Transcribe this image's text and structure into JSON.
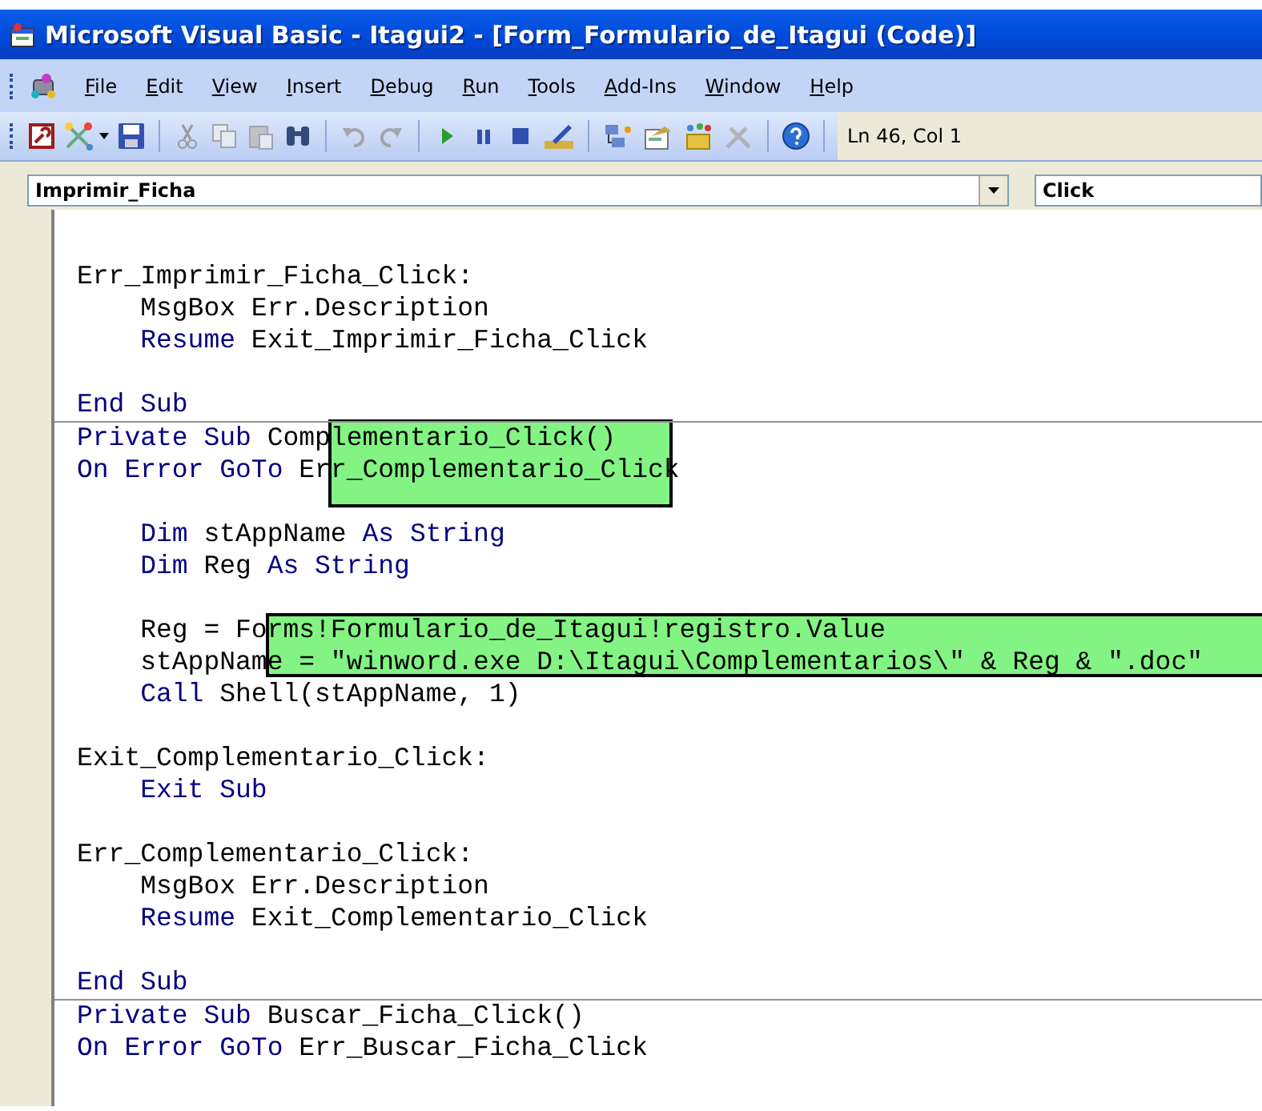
{
  "window": {
    "title": "Microsoft Visual Basic - Itagui2 - [Form_Formulario_de_Itagui (Code)]"
  },
  "menu": [
    "File",
    "Edit",
    "View",
    "Insert",
    "Debug",
    "Run",
    "Tools",
    "Add-Ins",
    "Window",
    "Help"
  ],
  "toolbar": {
    "position": "Ln 46, Col 1"
  },
  "object_combo": {
    "value": "Imprimir_Ficha"
  },
  "procedure_combo": {
    "value": "Click"
  },
  "code": [
    {
      "kind": "code",
      "tokens": [
        {
          "kind": "plain",
          "text": "Err_Imprimir_Ficha_Click:"
        }
      ]
    },
    {
      "kind": "code",
      "tokens": [
        {
          "kind": "plain",
          "text": "    MsgBox Err.Description"
        }
      ]
    },
    {
      "kind": "code",
      "tokens": [
        {
          "kind": "keyword",
          "text": "    Resume"
        },
        {
          "kind": "plain",
          "text": " Exit_Imprimir_Ficha_Click"
        }
      ]
    },
    {
      "kind": "blank"
    },
    {
      "kind": "code",
      "tokens": [
        {
          "kind": "keyword",
          "text": "End Sub"
        }
      ]
    },
    {
      "kind": "proc_start",
      "tokens": [
        {
          "kind": "keyword",
          "text": "Private Sub"
        },
        {
          "kind": "plain",
          "text": " Complementario_Click()"
        }
      ]
    },
    {
      "kind": "code",
      "tokens": [
        {
          "kind": "keyword",
          "text": "On Error GoTo"
        },
        {
          "kind": "plain",
          "text": " Err_Complementario_Click"
        }
      ]
    },
    {
      "kind": "blank"
    },
    {
      "kind": "code",
      "tokens": [
        {
          "kind": "keyword",
          "text": "    Dim"
        },
        {
          "kind": "plain",
          "text": " stAppName "
        },
        {
          "kind": "keyword",
          "text": "As String"
        }
      ]
    },
    {
      "kind": "code",
      "tokens": [
        {
          "kind": "keyword",
          "text": "    Dim"
        },
        {
          "kind": "plain",
          "text": " Reg "
        },
        {
          "kind": "keyword",
          "text": "As String"
        }
      ]
    },
    {
      "kind": "blank"
    },
    {
      "kind": "code",
      "tokens": [
        {
          "kind": "plain",
          "text": "    Reg = Forms!Formulario_de_Itagui!registro.Value"
        }
      ]
    },
    {
      "kind": "code",
      "tokens": [
        {
          "kind": "plain",
          "text": "    stAppName = \"winword.exe D:\\Itagui\\Complementarios\\\" & Reg & \".doc\""
        }
      ]
    },
    {
      "kind": "code",
      "tokens": [
        {
          "kind": "keyword",
          "text": "    Call"
        },
        {
          "kind": "plain",
          "text": " Shell(stAppName, 1)"
        }
      ]
    },
    {
      "kind": "blank"
    },
    {
      "kind": "code",
      "tokens": [
        {
          "kind": "plain",
          "text": "Exit_Complementario_Click:"
        }
      ]
    },
    {
      "kind": "code",
      "tokens": [
        {
          "kind": "keyword",
          "text": "    Exit Sub"
        }
      ]
    },
    {
      "kind": "blank"
    },
    {
      "kind": "code",
      "tokens": [
        {
          "kind": "plain",
          "text": "Err_Complementario_Click:"
        }
      ]
    },
    {
      "kind": "code",
      "tokens": [
        {
          "kind": "plain",
          "text": "    MsgBox Err.Description"
        }
      ]
    },
    {
      "kind": "code",
      "tokens": [
        {
          "kind": "keyword",
          "text": "    Resume"
        },
        {
          "kind": "plain",
          "text": " Exit_Complementario_Click"
        }
      ]
    },
    {
      "kind": "blank"
    },
    {
      "kind": "code",
      "tokens": [
        {
          "kind": "keyword",
          "text": "End Sub"
        }
      ]
    },
    {
      "kind": "proc_start",
      "tokens": [
        {
          "kind": "keyword",
          "text": "Private Sub"
        },
        {
          "kind": "plain",
          "text": " Buscar_Ficha_Click()"
        }
      ]
    },
    {
      "kind": "code",
      "tokens": [
        {
          "kind": "keyword",
          "text": "On Error GoTo"
        },
        {
          "kind": "plain",
          "text": " Err_Buscar_Ficha_Click"
        }
      ]
    }
  ]
}
